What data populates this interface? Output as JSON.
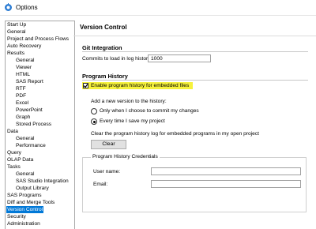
{
  "window": {
    "title": "Options",
    "icon": "options-gear-icon"
  },
  "nav": {
    "selected": "Version Control",
    "items": [
      {
        "label": "Start Up",
        "indent": 0
      },
      {
        "label": "General",
        "indent": 0
      },
      {
        "label": "Project and Process Flows",
        "indent": 0
      },
      {
        "label": "Auto Recovery",
        "indent": 0
      },
      {
        "label": "Results",
        "indent": 0
      },
      {
        "label": "General",
        "indent": 1
      },
      {
        "label": "Viewer",
        "indent": 1
      },
      {
        "label": "HTML",
        "indent": 1
      },
      {
        "label": "SAS Report",
        "indent": 1
      },
      {
        "label": "RTF",
        "indent": 1
      },
      {
        "label": "PDF",
        "indent": 1
      },
      {
        "label": "Excel",
        "indent": 1
      },
      {
        "label": "PowerPoint",
        "indent": 1
      },
      {
        "label": "Graph",
        "indent": 1
      },
      {
        "label": "Stored Process",
        "indent": 1
      },
      {
        "label": "Data",
        "indent": 0
      },
      {
        "label": "General",
        "indent": 1
      },
      {
        "label": "Performance",
        "indent": 1
      },
      {
        "label": "Query",
        "indent": 0
      },
      {
        "label": "OLAP Data",
        "indent": 0
      },
      {
        "label": "Tasks",
        "indent": 0
      },
      {
        "label": "General",
        "indent": 1
      },
      {
        "label": "SAS Studio Integration",
        "indent": 1
      },
      {
        "label": "Output Library",
        "indent": 1
      },
      {
        "label": "SAS Programs",
        "indent": 0
      },
      {
        "label": "Diff and Merge Tools",
        "indent": 0
      },
      {
        "label": "Version Control",
        "indent": 0
      },
      {
        "label": "Security",
        "indent": 0
      },
      {
        "label": "Administration",
        "indent": 0
      }
    ]
  },
  "page": {
    "title": "Version Control",
    "git": {
      "heading": "Git Integration",
      "commits_label": "Commits to load in log history:",
      "commits_value": "1000"
    },
    "history": {
      "heading": "Program History",
      "enable_label": "Enable program history for embedded files",
      "enable_checked": true,
      "add_version_label": "Add a new version to the history:",
      "option_commit": "Only when I choose to commit my changes",
      "option_save": "Every time I save my project",
      "selected_option": "save",
      "clear_desc": "Clear the program history log for embedded programs in my open project",
      "clear_button": "Clear",
      "credentials": {
        "group_label": "Program History Credentials",
        "user_label": "User name:",
        "user_value": "",
        "email_label": "Email:",
        "email_value": ""
      }
    }
  },
  "colors": {
    "selection": "#0078d7",
    "highlight": "#f6f23c"
  }
}
